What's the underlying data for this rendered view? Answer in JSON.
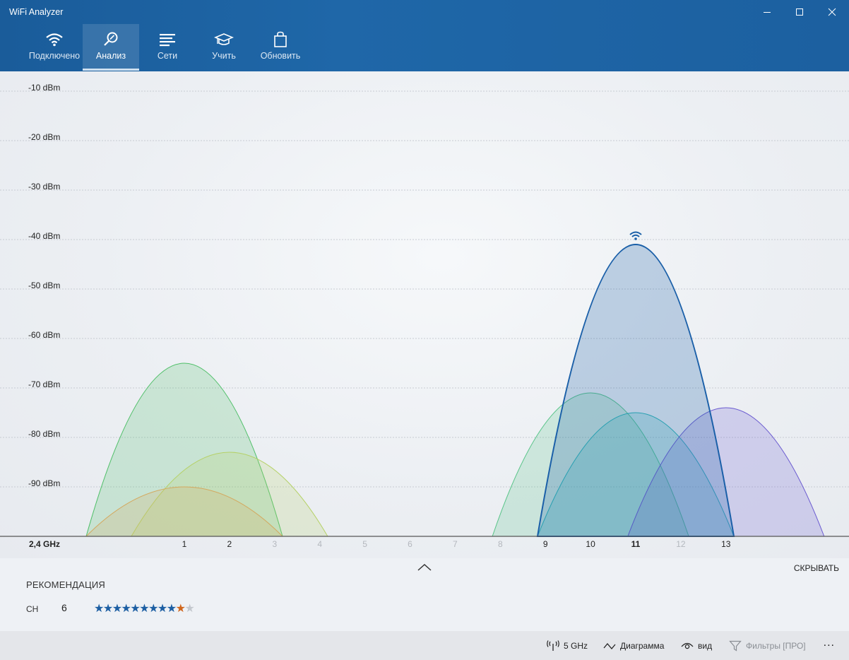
{
  "window": {
    "title": "WiFi Analyzer"
  },
  "nav": {
    "tabs": [
      {
        "label": "Подключено",
        "icon": "wifi-icon",
        "active": false
      },
      {
        "label": "Анализ",
        "icon": "analyze-icon",
        "active": true
      },
      {
        "label": "Сети",
        "icon": "networks-icon",
        "active": false
      },
      {
        "label": "Учить",
        "icon": "learn-icon",
        "active": false
      },
      {
        "label": "Обновить",
        "icon": "upgrade-icon",
        "active": false
      }
    ]
  },
  "chart_data": {
    "type": "area",
    "ylabel": "",
    "xlabel": "2,4 GHz",
    "y_ticks": [
      "-10 dBm",
      "-20 dBm",
      "-30 dBm",
      "-40 dBm",
      "-50 dBm",
      "-60 dBm",
      "-70 dBm",
      "-80 dBm",
      "-90 dBm"
    ],
    "ylim": [
      -100,
      0
    ],
    "x_ticks": [
      "1",
      "2",
      "3",
      "4",
      "5",
      "6",
      "7",
      "8",
      "9",
      "10",
      "11",
      "12",
      "13"
    ],
    "x_ticks_muted": [
      "3",
      "4",
      "5",
      "6",
      "7",
      "8",
      "12"
    ],
    "x_tick_bold": "11",
    "grid": true,
    "series": [
      {
        "channel": 1,
        "dbm": -65,
        "color": "#4fbf68"
      },
      {
        "channel": 2,
        "dbm": -83,
        "color": "#b5d167"
      },
      {
        "channel": 1,
        "dbm": -90,
        "color": "#d4a85e"
      },
      {
        "channel": 10,
        "dbm": -71,
        "color": "#58c488"
      },
      {
        "channel": 11,
        "dbm": -75,
        "color": "#2ab4b4"
      },
      {
        "channel": 13,
        "dbm": -74,
        "color": "#6a5ad0"
      },
      {
        "channel": 11,
        "dbm": -41,
        "color": "#1a5fa8",
        "connected": true
      }
    ]
  },
  "bottom": {
    "hide_label": "СКРЫВАТЬ",
    "recommendation_title": "РЕКОМЕНДАЦИЯ",
    "ch_label": "CH",
    "ch_value": "6",
    "rating": {
      "filled": 9,
      "highlight": 1,
      "empty": 1
    }
  },
  "commands": {
    "band": "5 GHz",
    "chart": "Диаграмма",
    "view": "вид",
    "filters": "Фильтры [ПРО]",
    "more": "..."
  }
}
